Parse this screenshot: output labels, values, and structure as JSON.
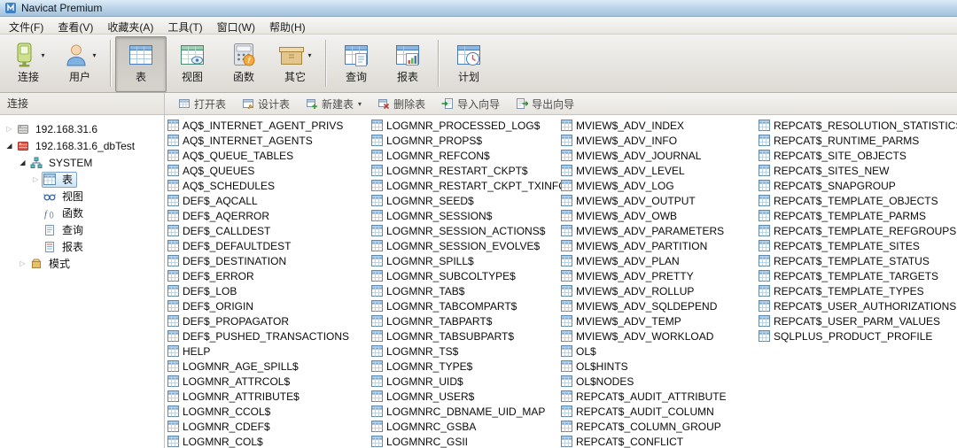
{
  "window": {
    "title": "Navicat Premium"
  },
  "menubar": {
    "items": [
      "文件(F)",
      "查看(V)",
      "收藏夹(A)",
      "工具(T)",
      "窗口(W)",
      "帮助(H)"
    ]
  },
  "toolbar": {
    "groups": [
      [
        {
          "label": "连接",
          "icon": "connection-icon",
          "dropdown": true,
          "pressed": false
        },
        {
          "label": "用户",
          "icon": "user-icon",
          "dropdown": true,
          "pressed": false
        }
      ],
      [
        {
          "label": "表",
          "icon": "table-icon",
          "dropdown": false,
          "pressed": true
        },
        {
          "label": "视图",
          "icon": "view-icon",
          "dropdown": false,
          "pressed": false
        },
        {
          "label": "函数",
          "icon": "function-icon",
          "dropdown": false,
          "pressed": false
        },
        {
          "label": "其它",
          "icon": "other-icon",
          "dropdown": true,
          "pressed": false
        }
      ],
      [
        {
          "label": "查询",
          "icon": "query-icon",
          "dropdown": false,
          "pressed": false
        },
        {
          "label": "报表",
          "icon": "report-icon",
          "dropdown": false,
          "pressed": false
        }
      ],
      [
        {
          "label": "计划",
          "icon": "schedule-icon",
          "dropdown": false,
          "pressed": false
        }
      ]
    ]
  },
  "sidebar": {
    "header": "连接",
    "tree": [
      {
        "label": "192.168.31.6",
        "icon": "server-gray-icon",
        "depth": 0,
        "expander": "collapsed",
        "selected": false
      },
      {
        "label": "192.168.31.6_dbTest",
        "icon": "server-red-icon",
        "depth": 0,
        "expander": "expanded",
        "selected": false
      },
      {
        "label": "SYSTEM",
        "icon": "schema-icon",
        "depth": 1,
        "expander": "expanded",
        "selected": false
      },
      {
        "label": "表",
        "icon": "tables-icon",
        "depth": 2,
        "expander": "collapsed",
        "selected": true
      },
      {
        "label": "视图",
        "icon": "views-icon",
        "depth": 2,
        "expander": "none",
        "selected": false
      },
      {
        "label": "函数",
        "icon": "functions-icon",
        "depth": 2,
        "expander": "none",
        "selected": false
      },
      {
        "label": "查询",
        "icon": "queries-icon",
        "depth": 2,
        "expander": "none",
        "selected": false
      },
      {
        "label": "报表",
        "icon": "reports-icon",
        "depth": 2,
        "expander": "none",
        "selected": false
      },
      {
        "label": "模式",
        "icon": "schemas-icon",
        "depth": 1,
        "expander": "collapsed",
        "selected": false
      }
    ]
  },
  "object_toolbar": {
    "buttons": [
      {
        "label": "打开表",
        "icon": "open-table-icon",
        "dropdown": false
      },
      {
        "label": "设计表",
        "icon": "design-table-icon",
        "dropdown": false
      },
      {
        "label": "新建表",
        "icon": "new-table-icon",
        "dropdown": true
      },
      {
        "label": "删除表",
        "icon": "delete-table-icon",
        "dropdown": false
      },
      {
        "label": "导入向导",
        "icon": "import-wizard-icon",
        "dropdown": false
      },
      {
        "label": "导出向导",
        "icon": "export-wizard-icon",
        "dropdown": false
      }
    ]
  },
  "tables": {
    "columns": [
      [
        "AQ$_INTERNET_AGENT_PRIVS",
        "AQ$_INTERNET_AGENTS",
        "AQ$_QUEUE_TABLES",
        "AQ$_QUEUES",
        "AQ$_SCHEDULES",
        "DEF$_AQCALL",
        "DEF$_AQERROR",
        "DEF$_CALLDEST",
        "DEF$_DEFAULTDEST",
        "DEF$_DESTINATION",
        "DEF$_ERROR",
        "DEF$_LOB",
        "DEF$_ORIGIN",
        "DEF$_PROPAGATOR",
        "DEF$_PUSHED_TRANSACTIONS",
        "HELP",
        "LOGMNR_AGE_SPILL$",
        "LOGMNR_ATTRCOL$",
        "LOGMNR_ATTRIBUTE$",
        "LOGMNR_CCOL$",
        "LOGMNR_CDEF$",
        "LOGMNR_COL$"
      ],
      [
        "LOGMNR_PROCESSED_LOG$",
        "LOGMNR_PROPS$",
        "LOGMNR_REFCON$",
        "LOGMNR_RESTART_CKPT$",
        "LOGMNR_RESTART_CKPT_TXINFO$",
        "LOGMNR_SEED$",
        "LOGMNR_SESSION$",
        "LOGMNR_SESSION_ACTIONS$",
        "LOGMNR_SESSION_EVOLVE$",
        "LOGMNR_SPILL$",
        "LOGMNR_SUBCOLTYPE$",
        "LOGMNR_TAB$",
        "LOGMNR_TABCOMPART$",
        "LOGMNR_TABPART$",
        "LOGMNR_TABSUBPART$",
        "LOGMNR_TS$",
        "LOGMNR_TYPE$",
        "LOGMNR_UID$",
        "LOGMNR_USER$",
        "LOGMNRC_DBNAME_UID_MAP",
        "LOGMNRC_GSBA",
        "LOGMNRC_GSII"
      ],
      [
        "MVIEW$_ADV_INDEX",
        "MVIEW$_ADV_INFO",
        "MVIEW$_ADV_JOURNAL",
        "MVIEW$_ADV_LEVEL",
        "MVIEW$_ADV_LOG",
        "MVIEW$_ADV_OUTPUT",
        "MVIEW$_ADV_OWB",
        "MVIEW$_ADV_PARAMETERS",
        "MVIEW$_ADV_PARTITION",
        "MVIEW$_ADV_PLAN",
        "MVIEW$_ADV_PRETTY",
        "MVIEW$_ADV_ROLLUP",
        "MVIEW$_ADV_SQLDEPEND",
        "MVIEW$_ADV_TEMP",
        "MVIEW$_ADV_WORKLOAD",
        "OL$",
        "OL$HINTS",
        "OL$NODES",
        "REPCAT$_AUDIT_ATTRIBUTE",
        "REPCAT$_AUDIT_COLUMN",
        "REPCAT$_COLUMN_GROUP",
        "REPCAT$_CONFLICT"
      ],
      [
        "REPCAT$_RESOLUTION_STATISTICS",
        "REPCAT$_RUNTIME_PARMS",
        "REPCAT$_SITE_OBJECTS",
        "REPCAT$_SITES_NEW",
        "REPCAT$_SNAPGROUP",
        "REPCAT$_TEMPLATE_OBJECTS",
        "REPCAT$_TEMPLATE_PARMS",
        "REPCAT$_TEMPLATE_REFGROUPS",
        "REPCAT$_TEMPLATE_SITES",
        "REPCAT$_TEMPLATE_STATUS",
        "REPCAT$_TEMPLATE_TARGETS",
        "REPCAT$_TEMPLATE_TYPES",
        "REPCAT$_USER_AUTHORIZATIONS",
        "REPCAT$_USER_PARM_VALUES",
        "SQLPLUS_PRODUCT_PROFILE"
      ]
    ]
  },
  "colors": {
    "titlebar_top": "#dcebf7",
    "titlebar_bottom": "#a4c2db",
    "toolbar_bg": "#ddddd4",
    "selection_border": "#7da2ce",
    "selection_fill": "#cfe4f7",
    "connection_active": "#e05a4e"
  }
}
